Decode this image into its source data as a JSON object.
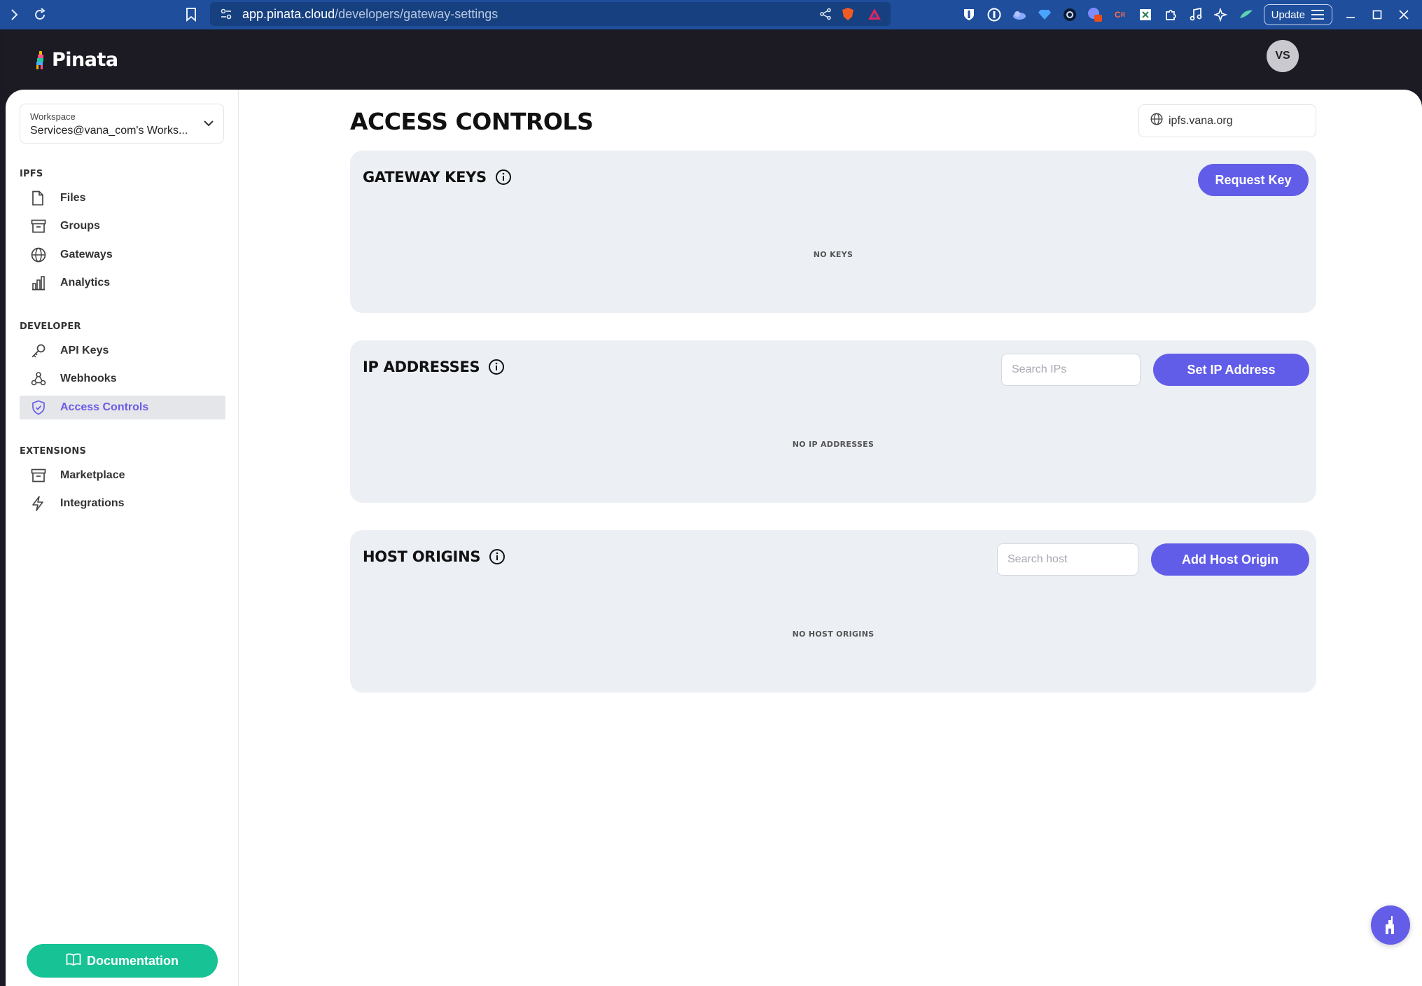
{
  "browser": {
    "url_host": "app.pinata.cloud",
    "url_path": "/developers/gateway-settings",
    "update_label": "Update"
  },
  "header": {
    "logo_text": "Pinata",
    "avatar_initials": "VS"
  },
  "sidebar": {
    "workspace_label": "Workspace",
    "workspace_value": "Services@vana_com's Works...",
    "sections": [
      {
        "title": "IPFS",
        "items": [
          {
            "label": "Files",
            "icon": "file-icon"
          },
          {
            "label": "Groups",
            "icon": "archive-icon"
          },
          {
            "label": "Gateways",
            "icon": "globe-icon"
          },
          {
            "label": "Analytics",
            "icon": "bar-chart-icon"
          }
        ]
      },
      {
        "title": "DEVELOPER",
        "items": [
          {
            "label": "API Keys",
            "icon": "key-icon"
          },
          {
            "label": "Webhooks",
            "icon": "webhook-icon"
          },
          {
            "label": "Access Controls",
            "icon": "shield-check-icon",
            "active": true
          }
        ]
      },
      {
        "title": "EXTENSIONS",
        "items": [
          {
            "label": "Marketplace",
            "icon": "archive-icon"
          },
          {
            "label": "Integrations",
            "icon": "lightning-icon"
          }
        ]
      }
    ],
    "documentation_label": "Documentation"
  },
  "main": {
    "title": "ACCESS CONTROLS",
    "gateway": "ipfs.vana.org",
    "cards": {
      "gateway_keys": {
        "title": "GATEWAY KEYS",
        "button": "Request Key",
        "empty": "NO KEYS"
      },
      "ip_addresses": {
        "title": "IP ADDRESSES",
        "search_placeholder": "Search IPs",
        "button": "Set IP Address",
        "empty": "NO IP ADDRESSES"
      },
      "host_origins": {
        "title": "HOST ORIGINS",
        "search_placeholder": "Search host",
        "button": "Add Host Origin",
        "empty": "NO HOST ORIGINS"
      }
    }
  },
  "colors": {
    "accent": "#625de8",
    "documentation_button": "#17c294",
    "header_bg": "#1c1b24",
    "card_bg": "#ecf0f5"
  }
}
